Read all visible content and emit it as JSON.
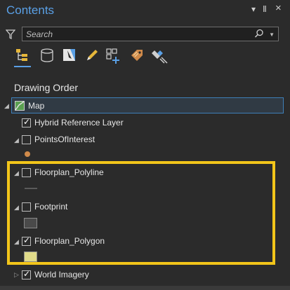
{
  "window": {
    "title": "Contents",
    "menu_glyph": "▾",
    "pin_glyph": "Ⅱ",
    "close_glyph": "×"
  },
  "search": {
    "placeholder": "Search"
  },
  "toolbar": {
    "tools": [
      "list-by-drawing-order",
      "list-by-data-source",
      "list-by-selection",
      "list-by-editing",
      "list-by-snapping",
      "list-by-labeling",
      "list-by-perspective-imagery"
    ]
  },
  "section": {
    "heading": "Drawing Order"
  },
  "layers": [
    {
      "name": "Map",
      "checked": null
    },
    {
      "name": "Hybrid Reference Layer",
      "checked": true
    },
    {
      "name": "PointsOfInterest",
      "checked": false
    },
    {
      "name": "Floorplan_Polyline",
      "checked": false
    },
    {
      "name": "Footprint",
      "checked": false
    },
    {
      "name": "Floorplan_Polygon",
      "checked": true
    },
    {
      "name": "World Imagery",
      "checked": true
    }
  ],
  "colors": {
    "accent": "#5aa0e6",
    "highlight": "#f2c51a",
    "poi_symbol": "#d08a4a",
    "polygon_symbol": "#e0db8a",
    "footprint_symbol": "#4a4a4a"
  }
}
